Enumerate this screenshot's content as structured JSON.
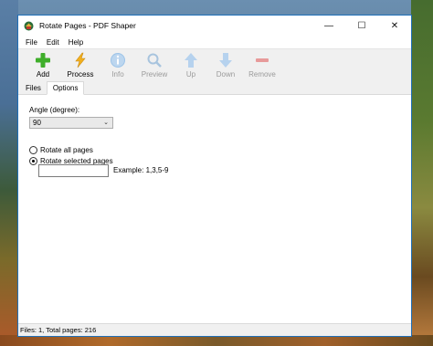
{
  "window": {
    "title": "Rotate Pages - PDF Shaper",
    "minimize_glyph": "—",
    "maximize_glyph": "☐",
    "close_glyph": "✕"
  },
  "menu": {
    "items": [
      "File",
      "Edit",
      "Help"
    ]
  },
  "toolbar": {
    "add": "Add",
    "process": "Process",
    "info": "Info",
    "preview": "Preview",
    "up": "Up",
    "down": "Down",
    "remove": "Remove"
  },
  "tabs": {
    "files": "Files",
    "options": "Options",
    "active": "Options"
  },
  "options": {
    "angle_label": "Angle (degree):",
    "angle_value": "90",
    "rotate_all_label": "Rotate all pages",
    "rotate_selected_label": "Rotate selected pages",
    "selected_mode": "Rotate selected pages",
    "pages_value": "",
    "example_text": "Example: 1,3,5-9"
  },
  "status": {
    "text": "Files: 1, Total pages: 216"
  },
  "colors": {
    "accent": "#1f6fb8",
    "add_green": "#3fae2a",
    "process_yellow": "#f2b01e",
    "disabled_blue": "#9cc3e8",
    "remove_red": "#e06060"
  }
}
